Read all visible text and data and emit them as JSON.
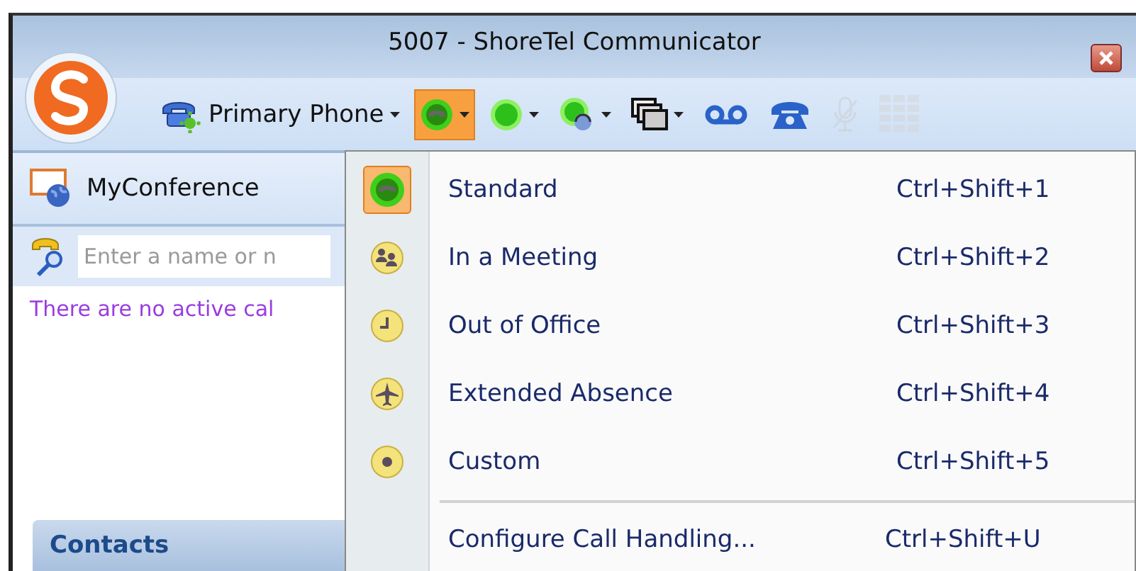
{
  "window": {
    "title": "5007 - ShoreTel Communicator"
  },
  "toolbar": {
    "phone_label": "Primary Phone",
    "buttons": [
      {
        "kind": "status",
        "selected": true,
        "disabled": false,
        "caret": true
      },
      {
        "kind": "presence",
        "selected": false,
        "disabled": false,
        "caret": true
      },
      {
        "kind": "headset",
        "selected": false,
        "disabled": false,
        "caret": true
      },
      {
        "kind": "windows",
        "selected": false,
        "disabled": false,
        "caret": true
      },
      {
        "kind": "voicemail",
        "selected": false,
        "disabled": false,
        "caret": false
      },
      {
        "kind": "handset",
        "selected": false,
        "disabled": false,
        "caret": false
      },
      {
        "kind": "mute",
        "selected": false,
        "disabled": true,
        "caret": false
      },
      {
        "kind": "dialpad",
        "selected": false,
        "disabled": true,
        "caret": false
      }
    ]
  },
  "conference": {
    "label": "MyConference"
  },
  "search": {
    "placeholder": "Enter a name or n"
  },
  "calls": {
    "message": "There are no active cal"
  },
  "contacts": {
    "header": "Contacts"
  },
  "menu": {
    "items": [
      {
        "kind": "standard",
        "label": "Standard",
        "shortcut": "Ctrl+Shift+1",
        "selected": true
      },
      {
        "kind": "meeting",
        "label": "In a Meeting",
        "shortcut": "Ctrl+Shift+2",
        "selected": false
      },
      {
        "kind": "office",
        "label": "Out of Office",
        "shortcut": "Ctrl+Shift+3",
        "selected": false
      },
      {
        "kind": "absence",
        "label": "Extended Absence",
        "shortcut": "Ctrl+Shift+4",
        "selected": false
      },
      {
        "kind": "custom",
        "label": "Custom",
        "shortcut": "Ctrl+Shift+5",
        "selected": false
      }
    ],
    "footer": {
      "label": "Configure Call Handling...",
      "shortcut": "Ctrl+Shift+U"
    }
  }
}
